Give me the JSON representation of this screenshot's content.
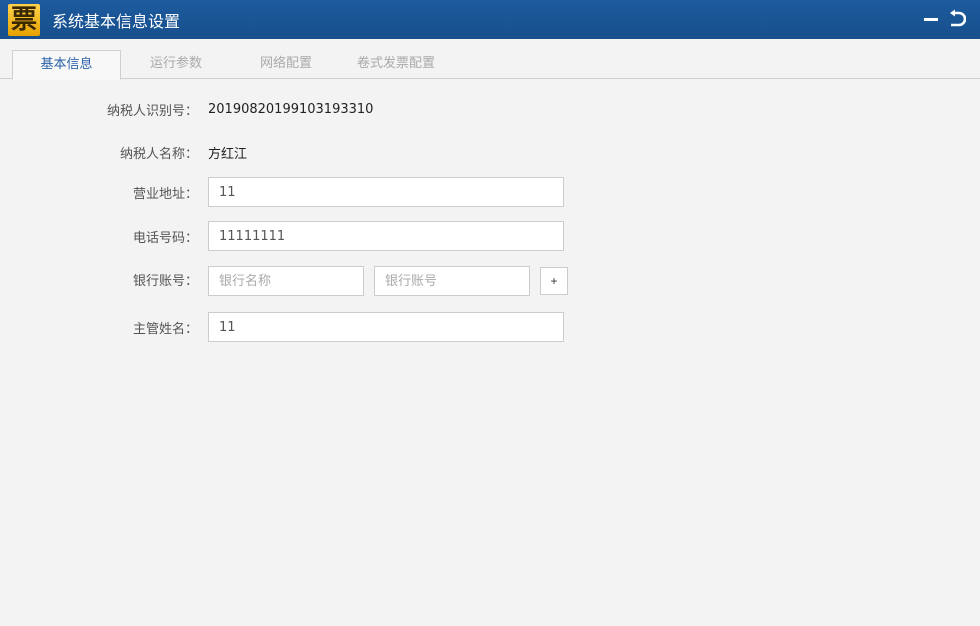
{
  "window": {
    "title": "系统基本信息设置",
    "logo_text": "票",
    "minimize_icon": "minus-icon",
    "back_icon": "return-icon"
  },
  "tabs": [
    {
      "label": "基本信息",
      "active": true
    },
    {
      "label": "运行参数"
    },
    {
      "label": "网络配置"
    },
    {
      "label": "卷式发票配置"
    }
  ],
  "form": {
    "taxpayer_id": {
      "label": "纳税人识别号：",
      "value": "2019082019910319331​0"
    },
    "taxpayer_name": {
      "label": "纳税人名称：",
      "value": "方红江"
    },
    "address": {
      "label": "营业地址：",
      "value": "11"
    },
    "phone": {
      "label": "电话号码：",
      "value": "11111111"
    },
    "bank": {
      "label": "银行账号：",
      "bank_name_placeholder": "银行名称",
      "account_placeholder": "银行账号",
      "add_label": "+"
    },
    "supervisor": {
      "label": "主管姓名：",
      "value": "11"
    }
  }
}
